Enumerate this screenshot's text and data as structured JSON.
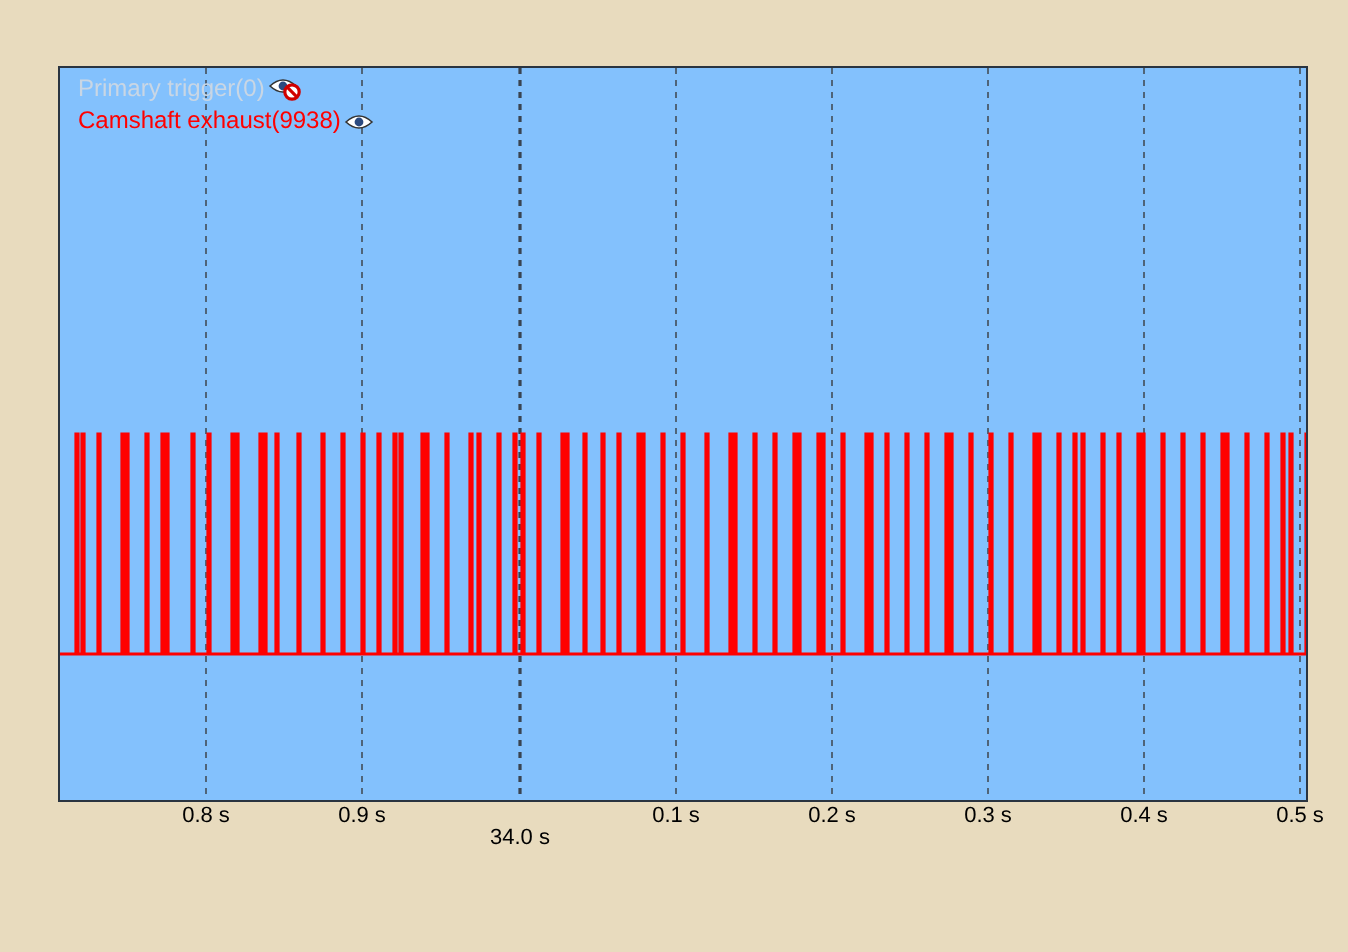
{
  "traces": [
    {
      "label": "Primary trigger(0)",
      "visible": false
    },
    {
      "label": "Camshaft exhaust(9938)",
      "visible": true,
      "color": "#ff0000"
    }
  ],
  "x_axis": {
    "ticks": [
      "0.8 s",
      "0.9 s",
      "0.1 s",
      "0.2 s",
      "0.3 s",
      "0.4 s",
      "0.5 s"
    ],
    "cursor_label": "34.0 s"
  }
}
